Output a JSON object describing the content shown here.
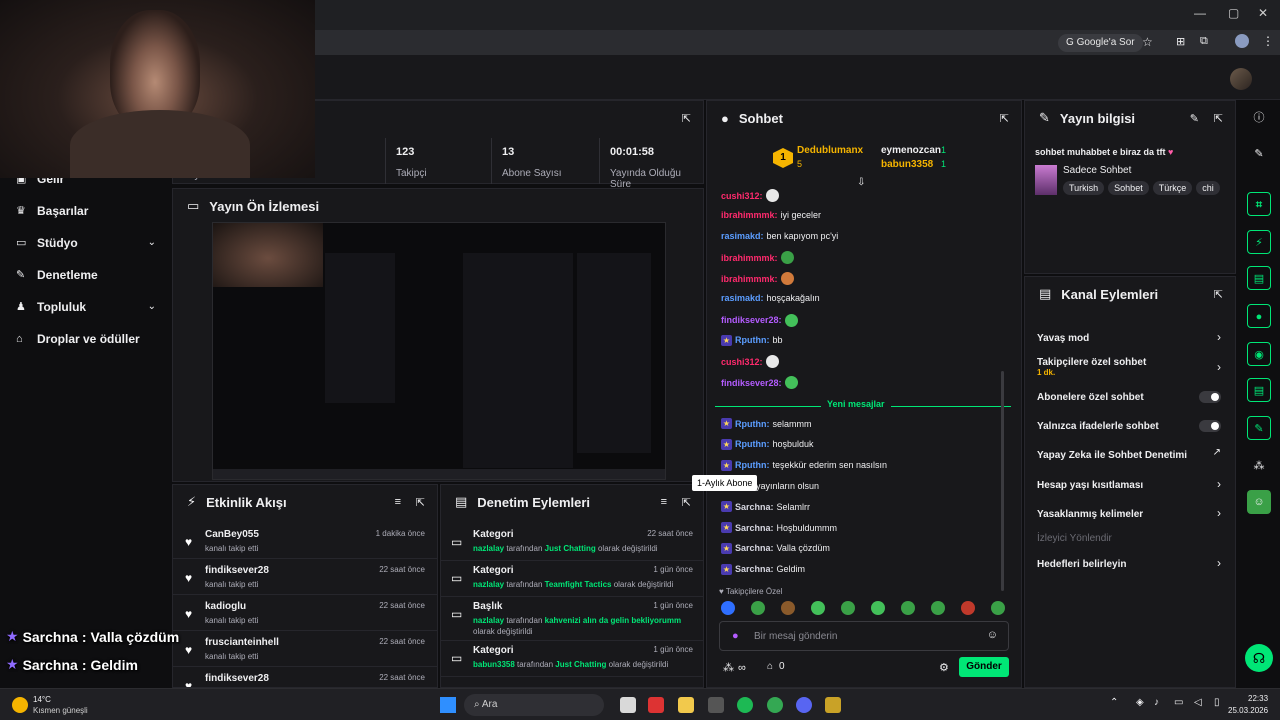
{
  "browser": {
    "google_search_label": "Google'a Sor"
  },
  "stats": [
    {
      "label": "Yayın",
      "value": ""
    },
    {
      "label": "Takipçi",
      "value": "123"
    },
    {
      "label": "Abone Sayısı",
      "value": "13"
    },
    {
      "label": "Yayında Olduğu Süre",
      "value": "00:01:58"
    }
  ],
  "left_nav": {
    "items": [
      {
        "label": "Gelir",
        "icon": "wallet-icon"
      },
      {
        "label": "Başarılar",
        "icon": "trophy-icon"
      },
      {
        "label": "Stüdyo",
        "icon": "studio-icon",
        "expandable": true
      },
      {
        "label": "Denetleme",
        "icon": "wrench-icon"
      },
      {
        "label": "Topluluk",
        "icon": "community-icon",
        "expandable": true
      },
      {
        "label": "Droplar ve ödüller",
        "icon": "gift-icon"
      }
    ]
  },
  "preview": {
    "title": "Yayın Ön İzlemesi"
  },
  "activity": {
    "title": "Etkinlik Akışı",
    "items": [
      {
        "name": "CanBey055",
        "sub": "kanalı takip etti",
        "time": "1 dakika önce"
      },
      {
        "name": "findiksever28",
        "sub": "kanalı takip etti",
        "time": "22 saat önce"
      },
      {
        "name": "kadioglu",
        "sub": "kanalı takip etti",
        "time": "22 saat önce"
      },
      {
        "name": "fruscianteinhell",
        "sub": "kanalı takip etti",
        "time": "22 saat önce"
      },
      {
        "name": "findiksever28",
        "sub": "",
        "time": "22 saat önce"
      }
    ]
  },
  "moderation": {
    "title": "Denetim Eylemleri",
    "items": [
      {
        "name": "Kategori",
        "user": "nazlalay",
        "mid": "tarafından",
        "target": "Just Chatting",
        "end": "olarak değiştirildi",
        "time": "22 saat önce"
      },
      {
        "name": "Kategori",
        "user": "nazlalay",
        "mid": "tarafından",
        "target": "Teamfight Tactics",
        "end": "olarak değiştirildi",
        "time": "1 gün önce"
      },
      {
        "name": "Başlık",
        "user": "nazlalay",
        "mid": "tarafından",
        "target": "kahvenizi alın da gelin bekliyorumm",
        "end": "olarak değiştirildi",
        "time": "1 gün önce"
      },
      {
        "name": "Kategori",
        "user": "babun3358",
        "mid": "tarafından",
        "target": "Just Chatting",
        "end": "olarak değiştirildi",
        "time": "1 gün önce"
      }
    ]
  },
  "chat": {
    "title": "Sohbet",
    "leaderboard": {
      "rank": "1",
      "first": "Dedublumanx",
      "first_count": "5",
      "others": [
        {
          "name": "eymenozcan",
          "count": "1"
        },
        {
          "name": "babun3358",
          "count": "1"
        }
      ]
    },
    "messages": [
      {
        "user": "cushi312",
        "color": "#ff2a6d",
        "text": "",
        "emote": "#e8e8e8"
      },
      {
        "user": "ibrahimmmk",
        "color": "#ff2a6d",
        "text": "iyi geceler"
      },
      {
        "user": "rasimakd",
        "color": "#5b9dff",
        "text": "ben kapıyom pc'yi"
      },
      {
        "user": "ibrahimmmk",
        "color": "#ff2a6d",
        "text": "",
        "emote": "#3aa047"
      },
      {
        "user": "ibrahimmmk",
        "color": "#ff2a6d",
        "text": "",
        "emote": "#d17a3b"
      },
      {
        "user": "rasimakd",
        "color": "#5b9dff",
        "text": "hoşçakağalın"
      },
      {
        "user": "findiksever28",
        "color": "#b45cff",
        "text": "",
        "emote": "#43c05a"
      },
      {
        "user": "Rputhn",
        "color": "#5b9dff",
        "text": "bb",
        "badge": true
      },
      {
        "user": "cushi312",
        "color": "#ff2a6d",
        "text": "",
        "emote": "#e8e8e8"
      },
      {
        "user": "findiksever28",
        "color": "#b45cff",
        "text": "",
        "emote": "#43c05a"
      }
    ],
    "new_messages_label": "Yeni mesajlar",
    "new_messages": [
      {
        "user": "Rputhn",
        "color": "#5b9dff",
        "text": "selammm"
      },
      {
        "user": "Rputhn",
        "color": "#5b9dff",
        "text": "hoşbulduk"
      },
      {
        "user": "Rputhn",
        "color": "#5b9dff",
        "text": "teşekkür ederim sen nasılsın"
      },
      {
        "user": "",
        "color": "#5b9dff",
        "text": "n: iyi yayınların olsun"
      },
      {
        "user": "Sarchna",
        "color": "#d6d6e0",
        "text": "Selamlrr"
      },
      {
        "user": "Sarchna",
        "color": "#d6d6e0",
        "text": "Hoşbuldummm"
      },
      {
        "user": "Sarchna",
        "color": "#d6d6e0",
        "text": "Valla çözdüm"
      },
      {
        "user": "Sarchna",
        "color": "#d6d6e0",
        "text": "Geldim"
      }
    ],
    "tooltip": "1-Aylık Abone",
    "followers_only_label": "Takipçilere Özel",
    "input_placeholder": "Bir mesaj gönderin",
    "points": "∞",
    "gifts": "0",
    "send_label": "Gönder"
  },
  "stream_info": {
    "title": "Yayın bilgisi",
    "stream_title": "sohbet muhabbet e biraz da tft",
    "category": "Sadece Sohbet",
    "tags": [
      "Turkish",
      "Sohbet",
      "Türkçe",
      "chi"
    ]
  },
  "channel_actions": {
    "title": "Kanal Eylemleri",
    "items": [
      {
        "label": "Yavaş mod",
        "type": "arrow"
      },
      {
        "label": "Takipçilere özel sohbet",
        "sub": "1 dk.",
        "type": "arrow"
      },
      {
        "label": "Abonelere özel sohbet",
        "type": "toggle"
      },
      {
        "label": "Yalnızca ifadelerle sohbet",
        "type": "toggle"
      },
      {
        "label": "Yapay Zeka ile Sohbet Denetimi",
        "type": "external"
      },
      {
        "label": "Hesap yaşı kısıtlaması",
        "type": "arrow"
      },
      {
        "label": "Yasaklanmış kelimeler",
        "type": "arrow"
      },
      {
        "label": "İzleyici Yönlendir",
        "type": "disabled"
      },
      {
        "label": "Hedefleri belirleyin",
        "type": "arrow"
      }
    ]
  },
  "overlay": {
    "messages": [
      {
        "user": "Sarchna",
        "text": "Valla çözdüm"
      },
      {
        "user": "Sarchna",
        "text": "Geldim"
      }
    ]
  },
  "taskbar": {
    "weather_temp": "14°C",
    "weather_desc": "Kısmen güneşli",
    "search_label": "Ara",
    "time": "22:33",
    "date": "25.03.2026"
  }
}
